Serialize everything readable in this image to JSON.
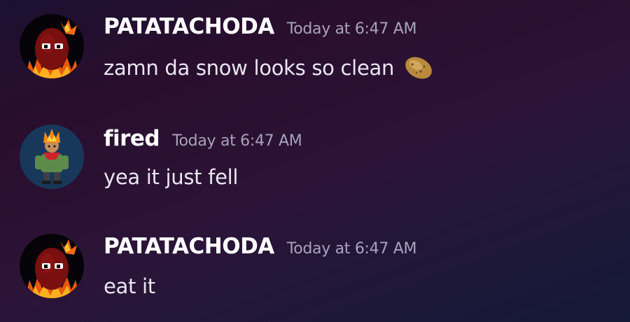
{
  "messages": [
    {
      "author": "PATATACHODA",
      "timestamp": "Today at 6:47 AM",
      "content": "zamn da snow looks so clean",
      "avatar_icon": "flaming-potato-avatar",
      "emoji": "potato-emoji"
    },
    {
      "author": "fired",
      "timestamp": "Today at 6:47 AM",
      "content": "yea it just fell",
      "avatar_icon": "fire-head-character-avatar"
    },
    {
      "author": "PATATACHODA",
      "timestamp": "Today at 6:47 AM",
      "content": "eat it",
      "avatar_icon": "flaming-potato-avatar"
    }
  ],
  "colors": {
    "author": "#ffffff",
    "timestamp": "#a7a3bb",
    "content": "#e9e6f2"
  }
}
